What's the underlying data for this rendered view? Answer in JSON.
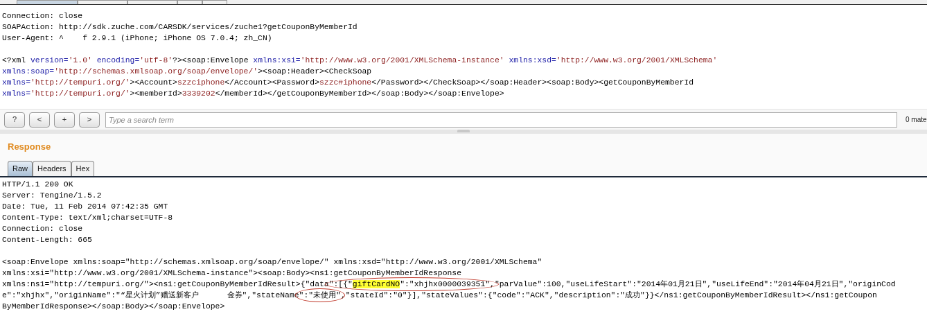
{
  "request": {
    "headers": [
      {
        "parts": [
          {
            "kind": "plain",
            "text": "Connection: close"
          }
        ]
      },
      {
        "parts": [
          {
            "kind": "plain",
            "text": "SOAPAction: http://sdk.zuche.com/CARSDK/services/zuche1?getCouponByMemberId"
          }
        ]
      },
      {
        "parts": [
          {
            "kind": "plain",
            "text": "User-Agent: ^    f 2.9.1 (iPhone; iPhone OS 7.0.4; zh_CN)"
          }
        ]
      }
    ],
    "body": [
      {
        "parts": [
          {
            "kind": "plain",
            "text": "<?xml "
          },
          {
            "kind": "attr",
            "text": "version="
          },
          {
            "kind": "value",
            "text": "'1.0'"
          },
          {
            "kind": "attr",
            "text": " encoding="
          },
          {
            "kind": "value",
            "text": "'utf-8'"
          },
          {
            "kind": "plain",
            "text": "?><soap:Envelope "
          },
          {
            "kind": "attr",
            "text": "xmlns:xsi="
          },
          {
            "kind": "value",
            "text": "'http://www.w3.org/2001/XMLSchema-instance'"
          },
          {
            "kind": "attr",
            "text": " xmlns:xsd="
          },
          {
            "kind": "value",
            "text": "'http://www.w3.org/2001/XMLSchema'"
          }
        ]
      },
      {
        "parts": [
          {
            "kind": "attr",
            "text": "xmlns:soap="
          },
          {
            "kind": "value",
            "text": "'http://schemas.xmlsoap.org/soap/envelope/'"
          },
          {
            "kind": "plain",
            "text": "><soap:Header><CheckSoap"
          }
        ]
      },
      {
        "parts": [
          {
            "kind": "attr",
            "text": "xmlns="
          },
          {
            "kind": "value",
            "text": "'http://tempuri.org/'"
          },
          {
            "kind": "plain",
            "text": "><Account>"
          },
          {
            "kind": "value",
            "text": "szzciphone"
          },
          {
            "kind": "plain",
            "text": "</Account><Password>"
          },
          {
            "kind": "value",
            "text": "szzc#iphone"
          },
          {
            "kind": "plain",
            "text": "</Password></CheckSoap></soap:Header><soap:Body><getCouponByMemberId"
          }
        ]
      },
      {
        "parts": [
          {
            "kind": "attr",
            "text": "xmlns="
          },
          {
            "kind": "value",
            "text": "'http://tempuri.org/'"
          },
          {
            "kind": "plain",
            "text": "><memberId>"
          },
          {
            "kind": "value",
            "text": "3339202"
          },
          {
            "kind": "plain",
            "text": "</memberId></getCouponByMemberId></soap:Body></soap:Envelope>"
          }
        ]
      }
    ]
  },
  "search": {
    "buttons": [
      "?",
      "<",
      "+",
      ">"
    ],
    "placeholder": "Type a search term",
    "matches": "0 mate"
  },
  "response": {
    "title": "Response",
    "tabs": [
      {
        "label": "Raw",
        "selected": true
      },
      {
        "label": "Headers",
        "selected": false
      },
      {
        "label": "Hex",
        "selected": false
      }
    ],
    "headers": [
      {
        "parts": [
          {
            "kind": "plain",
            "text": "HTTP/1.1 200 OK"
          }
        ]
      },
      {
        "parts": [
          {
            "kind": "plain",
            "text": "Server: Tengine/1.5.2"
          }
        ]
      },
      {
        "parts": [
          {
            "kind": "plain",
            "text": "Date: Tue, 11 Feb 2014 07:42:35 GMT"
          }
        ]
      },
      {
        "parts": [
          {
            "kind": "plain",
            "text": "Content-Type: text/xml;charset=UTF-8"
          }
        ]
      },
      {
        "parts": [
          {
            "kind": "plain",
            "text": "Connection: close"
          }
        ]
      },
      {
        "parts": [
          {
            "kind": "plain",
            "text": "Content-Length: 665"
          }
        ]
      }
    ],
    "body": [
      {
        "parts": [
          {
            "kind": "plain",
            "text": "<soap:Envelope xmlns:soap=\"http://schemas.xmlsoap.org/soap/envelope/\" xmlns:xsd=\"http://www.w3.org/2001/XMLSchema\""
          }
        ]
      },
      {
        "parts": [
          {
            "kind": "plain",
            "text": "xmlns:xsi=\"http://www.w3.org/2001/XMLSchema-instance\"><soap:Body><ns1:getCouponByMemberIdResponse"
          }
        ]
      },
      {
        "parts": [
          {
            "kind": "plain",
            "text": "xmlns:ns1=\"http://tempuri.org/\"><ns1:getCouponByMemberIdResult>{\"data"
          },
          {
            "kind": "circled",
            "parts": [
              {
                "kind": "plain",
                "text": "\":[{\""
              },
              {
                "kind": "highlight",
                "text": "giftCardNO"
              },
              {
                "kind": "plain",
                "text": "\":\"xhjhx0000039351\","
              }
            ]
          },
          {
            "kind": "plain",
            "text": "\"parValue\":100,\"useLifeStart\":\"2014年01月21日\",\"useLifeEnd\":\"2014年04月21日\",\"originCod"
          }
        ]
      },
      {
        "parts": [
          {
            "kind": "plain",
            "text": "e\":\"xhjhx\",\"originName\":\"“星火计划”赠送新客户      金券\",\"stateName"
          },
          {
            "kind": "circled",
            "parts": [
              {
                "kind": "plain",
                "text": "\":\"未使用\""
              }
            ]
          },
          {
            "kind": "plain",
            "text": ",\"stateId\":\"0\"}],\"stateValues\":{\"code\":\"ACK\",\"description\":\"成功\"}}</ns1:getCouponByMemberIdResult></ns1:getCoupon"
          }
        ]
      },
      {
        "parts": [
          {
            "kind": "plain",
            "text": "ByMemberIdResponse></soap:Body></soap:Envelope>"
          }
        ]
      }
    ]
  }
}
